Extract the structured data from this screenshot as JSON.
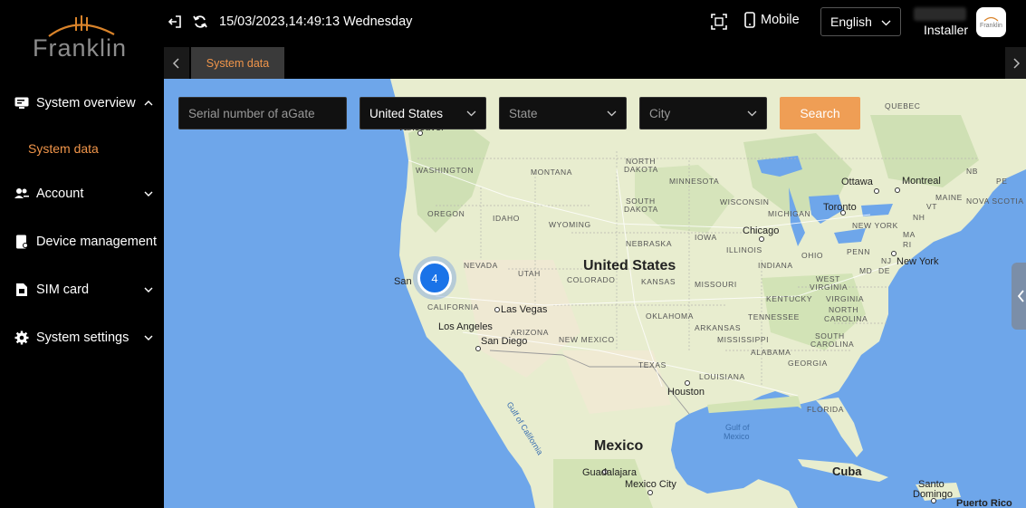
{
  "brand": {
    "name": "Franklin"
  },
  "header": {
    "datetime": "15/03/2023,14:49:13 Wednesday",
    "mobile_label": "Mobile",
    "language": "English",
    "role": "Installer",
    "avatar_text": "Franklin"
  },
  "sidebar": {
    "items": [
      {
        "label": "System overview",
        "icon": "monitor-icon",
        "expanded": true
      },
      {
        "label": "Account",
        "icon": "users-icon"
      },
      {
        "label": "Device management",
        "icon": "device-icon"
      },
      {
        "label": "SIM card",
        "icon": "sim-icon"
      },
      {
        "label": "System settings",
        "icon": "gear-icon"
      }
    ],
    "sub_items": [
      {
        "label": "System data",
        "active": true
      }
    ]
  },
  "tabs": [
    {
      "label": "System data",
      "active": true
    }
  ],
  "filters": {
    "serial_placeholder": "Serial number of aGate",
    "country": "United States",
    "state_placeholder": "State",
    "city_placeholder": "City",
    "search_label": "Search"
  },
  "map": {
    "cluster_count": "4",
    "labels": {
      "quebec": "QUEBEC",
      "vancouver": "Vancouver",
      "washington": "WASHINGTON",
      "montana": "MONTANA",
      "north_dakota_1": "NORTH",
      "north_dakota_2": "DAKOTA",
      "minnesota": "MINNESOTA",
      "ottawa": "Ottawa",
      "montreal": "Montreal",
      "nb": "NB",
      "pe": "PE",
      "maine": "MAINE",
      "nova_scotia": "NOVA SCOTIA",
      "oregon": "OREGON",
      "idaho": "IDAHO",
      "wyoming": "WYOMING",
      "south_dakota_1": "SOUTH",
      "south_dakota_2": "DAKOTA",
      "wisconsin": "WISCONSIN",
      "michigan": "MICHIGAN",
      "toronto": "Toronto",
      "vt": "VT",
      "nh": "NH",
      "new_york_state": "NEW YORK",
      "ma": "MA",
      "chicago": "Chicago",
      "nebraska": "NEBRASKA",
      "iowa": "IOWA",
      "illinois": "ILLINOIS",
      "ohio": "OHIO",
      "penn": "PENN",
      "ri": "RI",
      "nj": "NJ",
      "md": "MD",
      "de": "DE",
      "new_york": "New York",
      "nevada": "NEVADA",
      "utah": "UTAH",
      "united_states": "United States",
      "indiana": "INDIANA",
      "west_virginia_1": "WEST",
      "west_virginia_2": "VIRGINIA",
      "virginia": "VIRGINIA",
      "san": "San",
      "colorado": "COLORADO",
      "kansas": "KANSAS",
      "missouri": "MISSOURI",
      "kentucky": "KENTUCKY",
      "california": "CALIFORNIA",
      "las_vegas": "Las Vegas",
      "oklahoma": "OKLAHOMA",
      "tennessee": "TENNESSEE",
      "north_carolina_1": "NORTH",
      "north_carolina_2": "CAROLINA",
      "los_angeles": "Los Angeles",
      "arizona": "ARIZONA",
      "arkansas": "ARKANSAS",
      "south_carolina_1": "SOUTH",
      "south_carolina_2": "CAROLINA",
      "san_diego": "San Diego",
      "new_mexico": "NEW MEXICO",
      "mississippi": "MISSISSIPPI",
      "alabama": "ALABAMA",
      "georgia": "GEORGIA",
      "texas": "TEXAS",
      "louisiana": "LOUISIANA",
      "houston": "Houston",
      "florida": "FLORIDA",
      "gulf_california": "Gulf of California",
      "gulf_mexico_1": "Gulf of",
      "gulf_mexico_2": "Mexico",
      "mexico": "Mexico",
      "cuba": "Cuba",
      "guadalajara": "Guadalajara",
      "mexico_city": "Mexico City",
      "santo_domingo_1": "Santo",
      "santo_domingo_2": "Domingo",
      "puerto_rico": "Puerto Rico"
    }
  },
  "colors": {
    "accent": "#ef9e55",
    "sidebar_bg": "#000000",
    "ocean": "#6ea6ea",
    "land": "#e8edcf",
    "cluster": "#1a73e8"
  }
}
